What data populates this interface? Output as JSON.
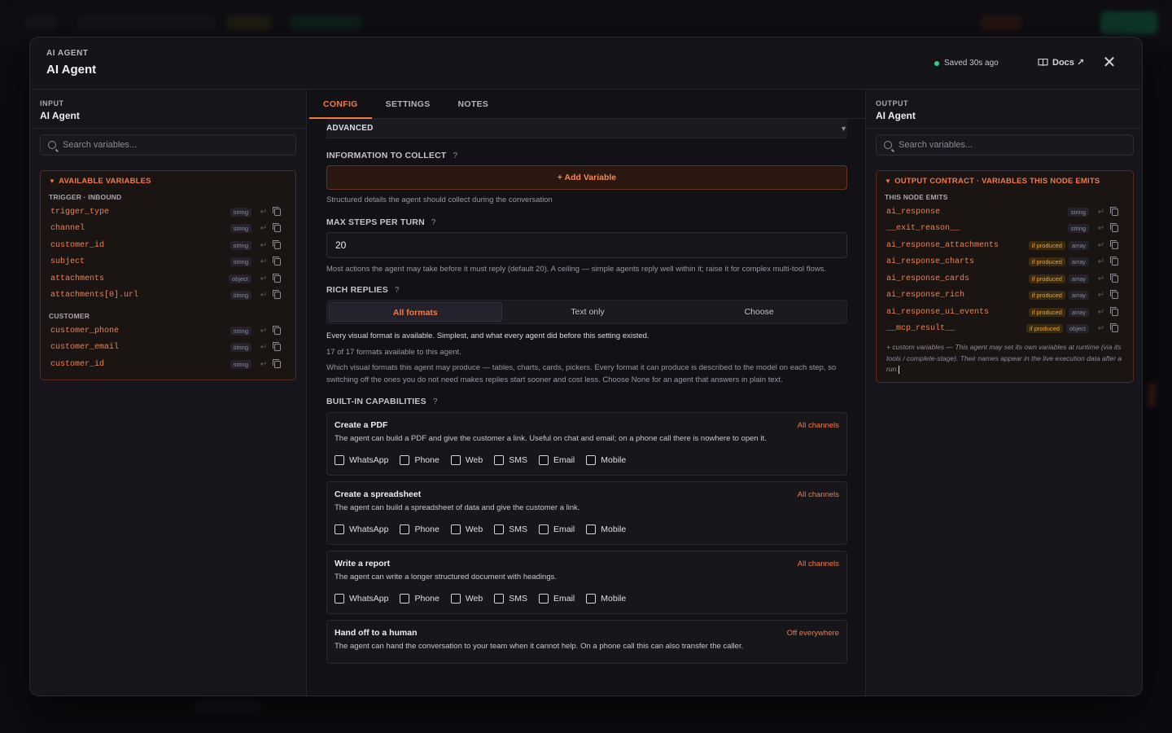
{
  "modal": {
    "eyebrow": "AI AGENT",
    "title": "AI Agent",
    "saved_status": "Saved 30s ago",
    "docs_label": "Docs ↗",
    "close_label": "✕"
  },
  "input_panel": {
    "eyebrow": "INPUT",
    "title": "AI Agent",
    "search_placeholder": "Search variables...",
    "box_title": "AVAILABLE VARIABLES",
    "groups": [
      {
        "label": "TRIGGER · INBOUND",
        "vars": [
          {
            "name": "trigger_type",
            "type": "string"
          },
          {
            "name": "channel",
            "type": "string"
          },
          {
            "name": "customer_id",
            "type": "string"
          },
          {
            "name": "subject",
            "type": "string"
          },
          {
            "name": "attachments",
            "type": "object"
          },
          {
            "name": "attachments[0].url",
            "type": "string"
          }
        ]
      },
      {
        "label": "CUSTOMER",
        "vars": [
          {
            "name": "customer_phone",
            "type": "string"
          },
          {
            "name": "customer_email",
            "type": "string"
          },
          {
            "name": "customer_id",
            "type": "string"
          }
        ]
      }
    ]
  },
  "output_panel": {
    "eyebrow": "OUTPUT",
    "title": "AI Agent",
    "search_placeholder": "Search variables...",
    "box_title": "OUTPUT CONTRACT · VARIABLES THIS NODE EMITS",
    "group_label": "THIS NODE EMITS",
    "produced_label": "if produced",
    "vars": [
      {
        "name": "ai_response",
        "type": "string",
        "conditional": false
      },
      {
        "name": "__exit_reason__",
        "type": "string",
        "conditional": false
      },
      {
        "name": "ai_response_attachments",
        "type": "array",
        "conditional": true
      },
      {
        "name": "ai_response_charts",
        "type": "array",
        "conditional": true
      },
      {
        "name": "ai_response_cards",
        "type": "array",
        "conditional": true
      },
      {
        "name": "ai_response_rich",
        "type": "array",
        "conditional": true
      },
      {
        "name": "ai_response_ui_events",
        "type": "array",
        "conditional": true
      },
      {
        "name": "__mcp_result__",
        "type": "object",
        "conditional": true
      }
    ],
    "custom_note": "+ custom variables — This agent may set its own variables at runtime (via its tools / complete-stage). Their names appear in the live execution data after a run."
  },
  "tabs": [
    "CONFIG",
    "SETTINGS",
    "NOTES"
  ],
  "config": {
    "advanced_label": "ADVANCED",
    "info_collect": {
      "label": "INFORMATION TO COLLECT",
      "help": "?",
      "button": "+ Add Variable",
      "hint": "Structured details the agent should collect during the conversation"
    },
    "max_steps": {
      "label": "MAX STEPS PER TURN",
      "help": "?",
      "value": "20",
      "hint": "Most actions the agent may take before it must reply (default 20). A ceiling — simple agents reply well within it; raise it for complex multi-tool flows."
    },
    "rich_replies": {
      "label": "RICH REPLIES",
      "help": "?",
      "options": [
        "All formats",
        "Text only",
        "Choose"
      ],
      "selected": "All formats",
      "desc1": "Every visual format is available. Simplest, and what every agent did before this setting existed.",
      "desc2": "17 of 17 formats available to this agent.",
      "desc3": "Which visual formats this agent may produce — tables, charts, cards, pickers. Every format it can produce is described to the model on each step, so switching off the ones you do not need makes replies start sooner and cost less. Choose None for an agent that answers in plain text."
    },
    "capabilities": {
      "label": "BUILT-IN CAPABILITIES",
      "help": "?",
      "channels": [
        "WhatsApp",
        "Phone",
        "Web",
        "SMS",
        "Email",
        "Mobile"
      ],
      "items": [
        {
          "title": "Create a PDF",
          "scope": "All channels",
          "desc": "The agent can build a PDF and give the customer a link. Useful on chat and email; on a phone call there is nowhere to open it."
        },
        {
          "title": "Create a spreadsheet",
          "scope": "All channels",
          "desc": "The agent can build a spreadsheet of data and give the customer a link."
        },
        {
          "title": "Write a report",
          "scope": "All channels",
          "desc": "The agent can write a longer structured document with headings."
        },
        {
          "title": "Hand off to a human",
          "scope": "Off everywhere",
          "desc": "The agent can hand the conversation to your team when it cannot help. On a phone call this can also transfer the caller."
        }
      ]
    }
  }
}
